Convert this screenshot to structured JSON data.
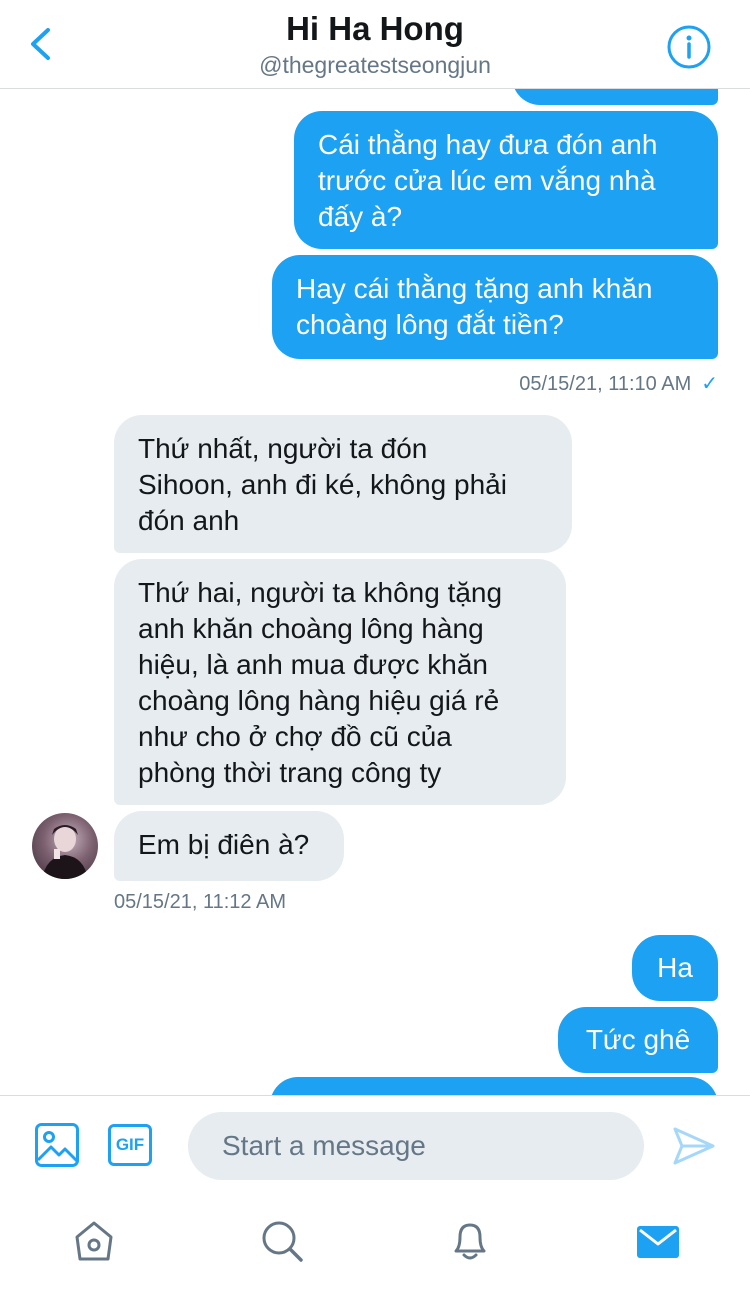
{
  "header": {
    "title": "Hi Ha Hong",
    "handle": "@thegreatestseongjun"
  },
  "messages": [
    {
      "direction": "outgoing",
      "text": "Cái thằng hay đưa đón anh\ntrước cửa lúc em vắng nhà\nđấy à?"
    },
    {
      "direction": "outgoing",
      "text": "Hay cái thằng tặng anh khăn\nchoàng lông đắt tiền?"
    },
    {
      "direction": "incoming",
      "text": "Thứ nhất, người ta đón\nSihoon, anh đi ké, không phải\nđón anh"
    },
    {
      "direction": "incoming",
      "text": "Thứ hai, người ta không tặng\nanh khăn choàng lông hàng\nhiệu, là anh mua được khăn\nchoàng lông hàng hiệu giá rẻ\nnhư cho ở chợ đồ cũ của\nphòng thời trang công ty"
    },
    {
      "direction": "incoming",
      "text": "Em bị điên à?"
    },
    {
      "direction": "outgoing",
      "text": "Ha"
    },
    {
      "direction": "outgoing",
      "text": "Tức ghê"
    }
  ],
  "timestamps": {
    "outgoing_1": "05/15/21, 11:10 AM",
    "outgoing_1_status": "✓",
    "incoming_1": "05/15/21, 11:12 AM"
  },
  "composer": {
    "placeholder": "Start a message",
    "gif_label": "GIF"
  },
  "colors": {
    "accent": "#1da1f2",
    "incoming_bubble": "#e6ecf0",
    "muted_text": "#657786"
  },
  "icons": {
    "back": "chevron-left-icon",
    "info": "info-icon",
    "image": "image-icon",
    "send": "send-icon",
    "tabs": [
      "home-icon",
      "search-icon",
      "notifications-icon",
      "messages-icon"
    ]
  },
  "tabs": {
    "active": "messages"
  }
}
